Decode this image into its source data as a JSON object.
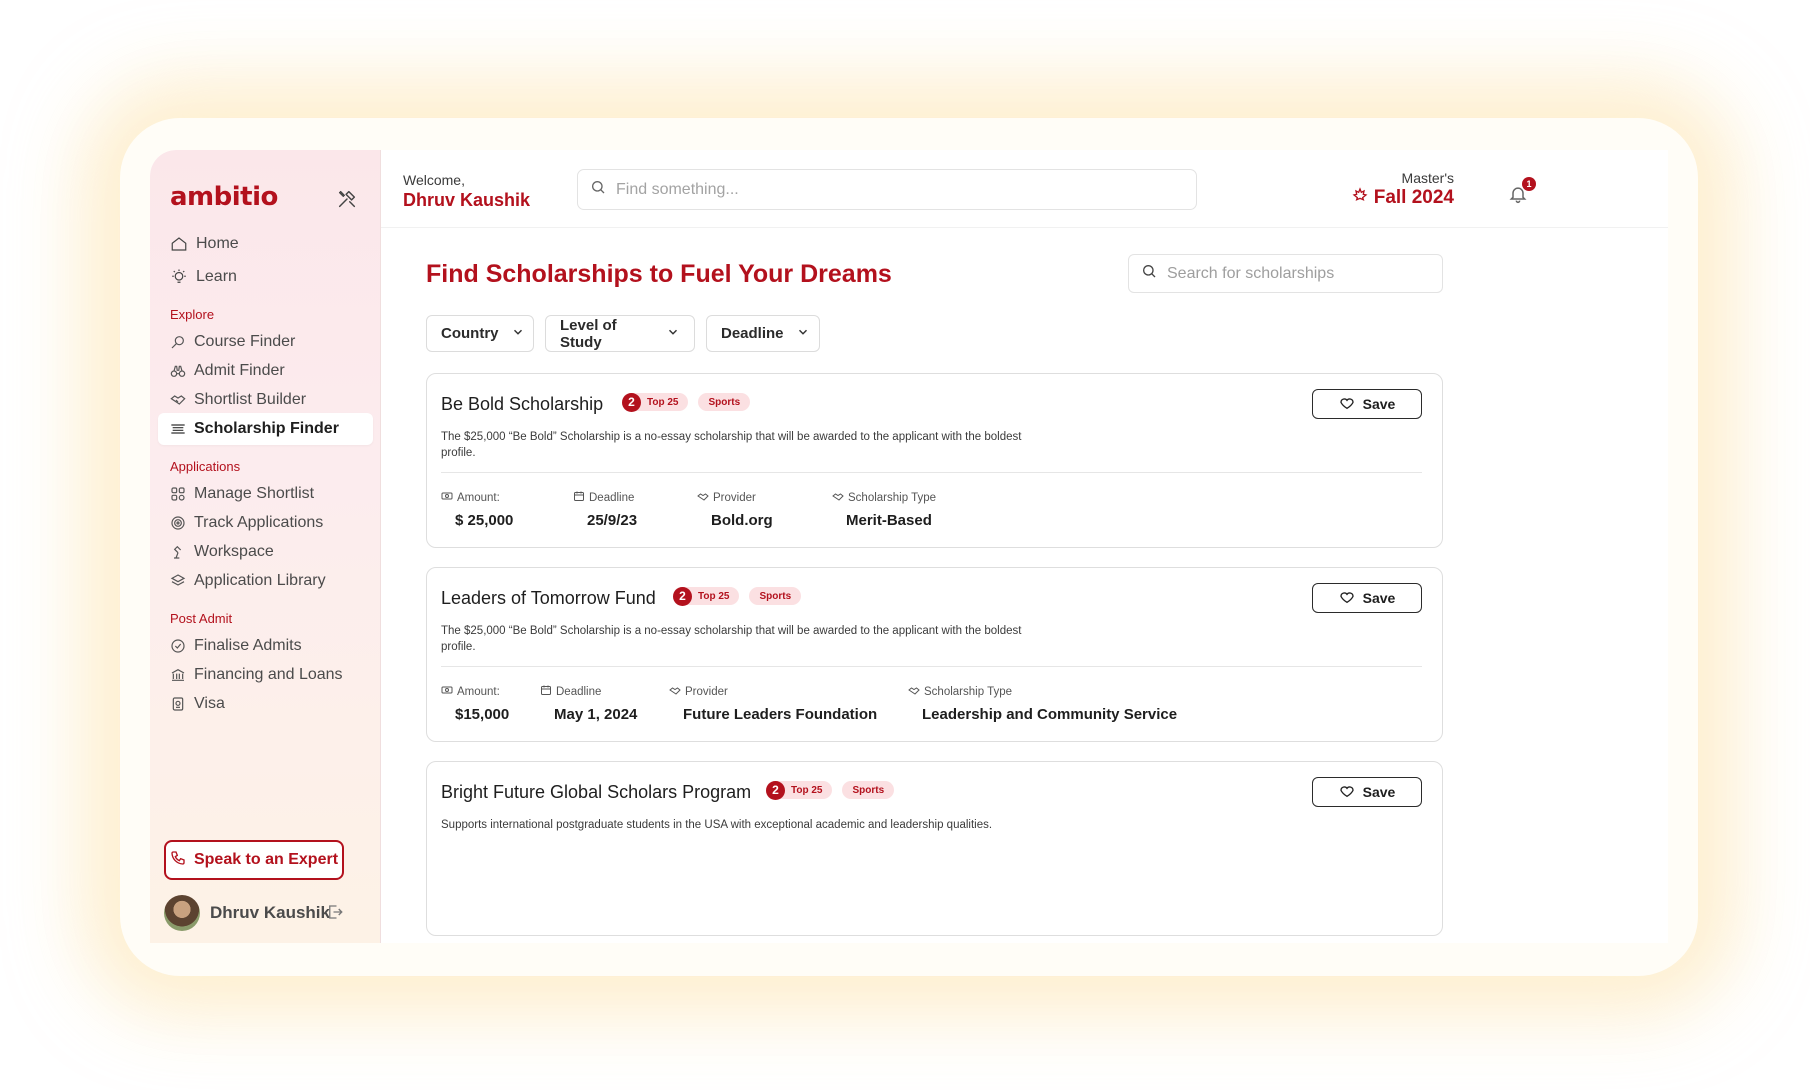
{
  "brand": {
    "logo": "ambitio",
    "accent": "#b3111d"
  },
  "sidebar": {
    "top_items": [
      {
        "label": "Home",
        "icon": "home-icon"
      },
      {
        "label": "Learn",
        "icon": "bulb-icon"
      }
    ],
    "sections": [
      {
        "title": "Explore",
        "items": [
          "Course Finder",
          "Admit Finder",
          "Shortlist Builder",
          "Scholarship Finder"
        ]
      },
      {
        "title": "Applications",
        "items": [
          "Manage Shortlist",
          "Track Applications",
          "Workspace",
          "Application Library"
        ]
      },
      {
        "title": "Post Admit",
        "items": [
          "Finalise Admits",
          "Financing and Loans",
          "Visa"
        ]
      }
    ],
    "active_item": "Scholarship Finder",
    "expert_button": "Speak to an Expert",
    "user_name": "Dhruv Kaushik"
  },
  "header": {
    "welcome": "Welcome,",
    "user_name": "Dhruv Kaushik",
    "search_placeholder": "Find something...",
    "intake_label": "Master's",
    "intake_value": "Fall 2024",
    "notification_count": "1"
  },
  "main": {
    "title": "Find Scholarships to Fuel Your Dreams",
    "search_placeholder": "Search for scholarships",
    "filters": [
      "Country",
      "Level of Study",
      "Deadline"
    ],
    "field_labels": {
      "amount": "Amount:",
      "deadline": "Deadline",
      "provider": "Provider",
      "type": "Scholarship Type"
    },
    "save_label": "Save",
    "cards": [
      {
        "title": "Be Bold Scholarship",
        "rank_badge": "Top 25",
        "tag": "Sports",
        "description": "The $25,000 “Be Bold” Scholarship is a no-essay scholarship that will be awarded to the applicant with the boldest profile.",
        "amount": "$ 25,000",
        "deadline": "25/9/23",
        "provider": "Bold.org",
        "type": "Merit-Based"
      },
      {
        "title": "Leaders of Tomorrow Fund",
        "rank_badge": "Top 25",
        "tag": "Sports",
        "description": "The $25,000 “Be Bold” Scholarship is a no-essay scholarship that will be awarded to the applicant with the boldest profile.",
        "amount": "$15,000",
        "deadline": "May 1, 2024",
        "provider": "Future Leaders Foundation",
        "type": "Leadership and Community Service"
      },
      {
        "title": "Bright Future Global Scholars Program",
        "rank_badge": "Top 25",
        "tag": "Sports",
        "description": "Supports international postgraduate students in the USA with exceptional academic and leadership qualities."
      }
    ]
  }
}
